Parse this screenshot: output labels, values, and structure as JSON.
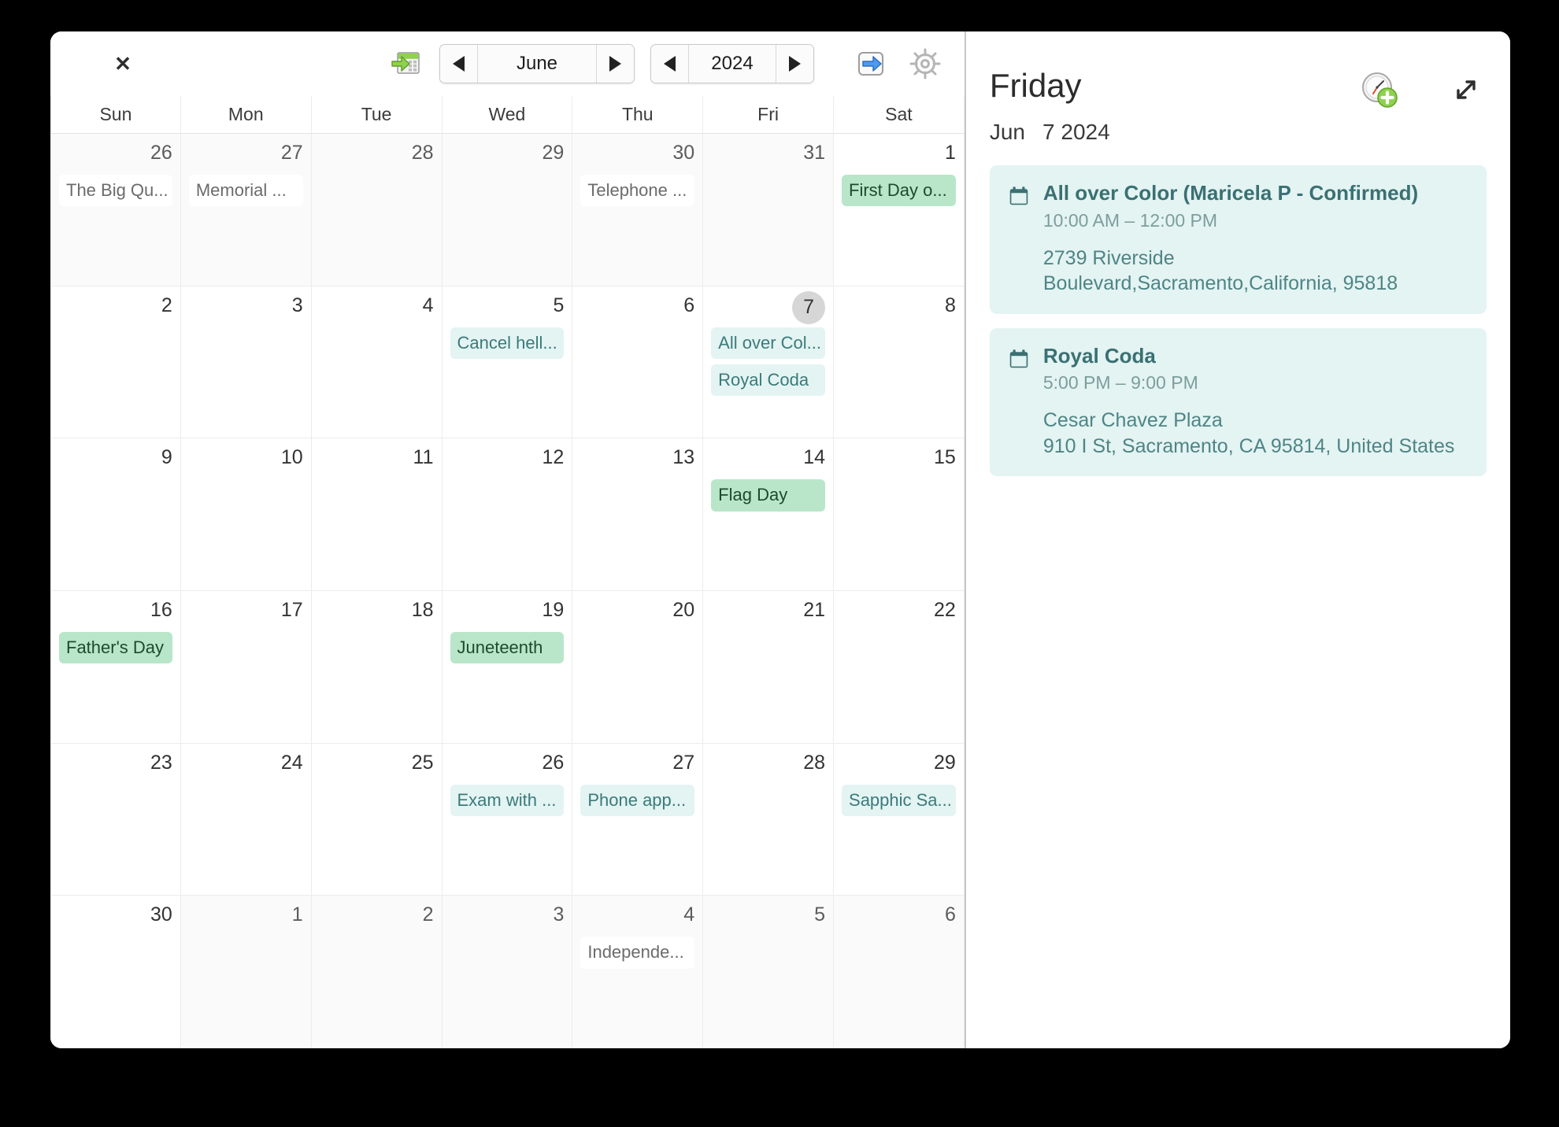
{
  "window": {
    "close_label": "✕"
  },
  "toolbar": {
    "goto_today_icon": "calendar-arrow-icon",
    "month_prev_icon": "chevron-left-icon",
    "month": "June",
    "month_next_icon": "chevron-right-icon",
    "year_prev_icon": "chevron-left-icon",
    "year": "2024",
    "year_next_icon": "chevron-right-icon",
    "export_icon": "export-arrow-icon",
    "settings_icon": "gear-icon"
  },
  "weekdays": [
    "Sun",
    "Mon",
    "Tue",
    "Wed",
    "Thu",
    "Fri",
    "Sat"
  ],
  "colors": {
    "event_teal_bg": "#e3f4f2",
    "event_teal_text": "#3c7a7b",
    "event_green_bg": "#b9e6c9",
    "event_green_text": "#1d4a2c",
    "selected_day_bg": "#d6d6d6",
    "card_bg": "#e3f4f2",
    "card_title": "#3b7073",
    "divider": "#c7c7c7"
  },
  "grid": [
    {
      "day": "26",
      "out": true,
      "events": [
        {
          "label": "The Big Qu...",
          "style": "muted"
        }
      ]
    },
    {
      "day": "27",
      "out": true,
      "events": [
        {
          "label": "Memorial ...",
          "style": "muted"
        }
      ]
    },
    {
      "day": "28",
      "out": true,
      "events": []
    },
    {
      "day": "29",
      "out": true,
      "events": []
    },
    {
      "day": "30",
      "out": true,
      "events": [
        {
          "label": "Telephone ...",
          "style": "muted"
        }
      ]
    },
    {
      "day": "31",
      "out": true,
      "events": []
    },
    {
      "day": "1",
      "out": false,
      "events": [
        {
          "label": "First Day o...",
          "style": "green"
        }
      ]
    },
    {
      "day": "2",
      "out": false,
      "events": []
    },
    {
      "day": "3",
      "out": false,
      "events": []
    },
    {
      "day": "4",
      "out": false,
      "events": []
    },
    {
      "day": "5",
      "out": false,
      "events": [
        {
          "label": "Cancel hell...",
          "style": "teal"
        }
      ]
    },
    {
      "day": "6",
      "out": false,
      "events": []
    },
    {
      "day": "7",
      "out": false,
      "selected": true,
      "events": [
        {
          "label": "All over Col...",
          "style": "teal"
        },
        {
          "label": "Royal Coda",
          "style": "teal"
        }
      ]
    },
    {
      "day": "8",
      "out": false,
      "events": []
    },
    {
      "day": "9",
      "out": false,
      "events": []
    },
    {
      "day": "10",
      "out": false,
      "events": []
    },
    {
      "day": "11",
      "out": false,
      "events": []
    },
    {
      "day": "12",
      "out": false,
      "events": []
    },
    {
      "day": "13",
      "out": false,
      "events": []
    },
    {
      "day": "14",
      "out": false,
      "events": [
        {
          "label": "Flag Day",
          "style": "green"
        }
      ]
    },
    {
      "day": "15",
      "out": false,
      "events": []
    },
    {
      "day": "16",
      "out": false,
      "events": [
        {
          "label": "Father's Day",
          "style": "green"
        }
      ]
    },
    {
      "day": "17",
      "out": false,
      "events": []
    },
    {
      "day": "18",
      "out": false,
      "events": []
    },
    {
      "day": "19",
      "out": false,
      "events": [
        {
          "label": "Juneteenth",
          "style": "green"
        }
      ]
    },
    {
      "day": "20",
      "out": false,
      "events": []
    },
    {
      "day": "21",
      "out": false,
      "events": []
    },
    {
      "day": "22",
      "out": false,
      "events": []
    },
    {
      "day": "23",
      "out": false,
      "events": []
    },
    {
      "day": "24",
      "out": false,
      "events": []
    },
    {
      "day": "25",
      "out": false,
      "events": []
    },
    {
      "day": "26",
      "out": false,
      "events": [
        {
          "label": "Exam with ...",
          "style": "teal"
        }
      ]
    },
    {
      "day": "27",
      "out": false,
      "events": [
        {
          "label": "Phone app...",
          "style": "teal"
        }
      ]
    },
    {
      "day": "28",
      "out": false,
      "events": []
    },
    {
      "day": "29",
      "out": false,
      "events": [
        {
          "label": "Sapphic Sa...",
          "style": "teal"
        }
      ]
    },
    {
      "day": "30",
      "out": false,
      "events": []
    },
    {
      "day": "1",
      "out": true,
      "events": []
    },
    {
      "day": "2",
      "out": true,
      "events": []
    },
    {
      "day": "3",
      "out": true,
      "events": []
    },
    {
      "day": "4",
      "out": true,
      "events": [
        {
          "label": "Independe...",
          "style": "muted"
        }
      ]
    },
    {
      "day": "5",
      "out": true,
      "events": []
    },
    {
      "day": "6",
      "out": true,
      "events": []
    }
  ],
  "detail": {
    "weekday": "Friday",
    "month_day": "Jun",
    "day_year": "7 2024",
    "add_event_icon": "clock-add-icon",
    "expand_icon": "expand-arrows-icon",
    "events": [
      {
        "icon": "calendar-icon",
        "title": "All over Color (Maricela P - Confirmed)",
        "time": "10:00 AM – 12:00 PM",
        "location": "2739 Riverside Boulevard,Sacramento,California, 95818"
      },
      {
        "icon": "calendar-icon",
        "title": "Royal Coda",
        "time": "5:00 PM – 9:00 PM",
        "location": "Cesar Chavez Plaza\n910 I St, Sacramento, CA  95814, United States"
      }
    ]
  }
}
